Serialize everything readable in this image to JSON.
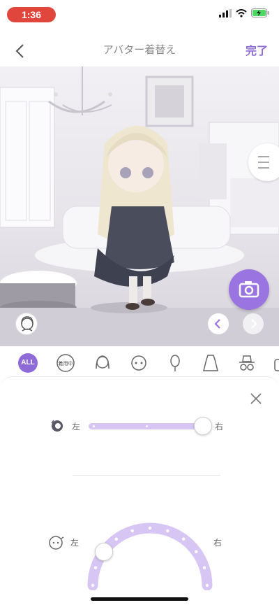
{
  "status_bar": {
    "time": "1:36"
  },
  "nav": {
    "title": "アバター着替え",
    "done_label": "完了"
  },
  "categories": {
    "all_label": "ALL",
    "wearing_label": "着用中",
    "items": [
      "hair-icon",
      "face-icon",
      "mirror-icon",
      "dress-icon",
      "hat-icon",
      "bag-icon"
    ]
  },
  "sheet": {
    "row1": {
      "left_label": "左",
      "right_label": "右",
      "level": 1.0
    },
    "row2": {
      "left_label": "左",
      "right_label": "右",
      "level": 0.2
    }
  },
  "colors": {
    "accent": "#8e6bd6",
    "track": "#d7c6f4",
    "status_red": "#e0463c"
  }
}
